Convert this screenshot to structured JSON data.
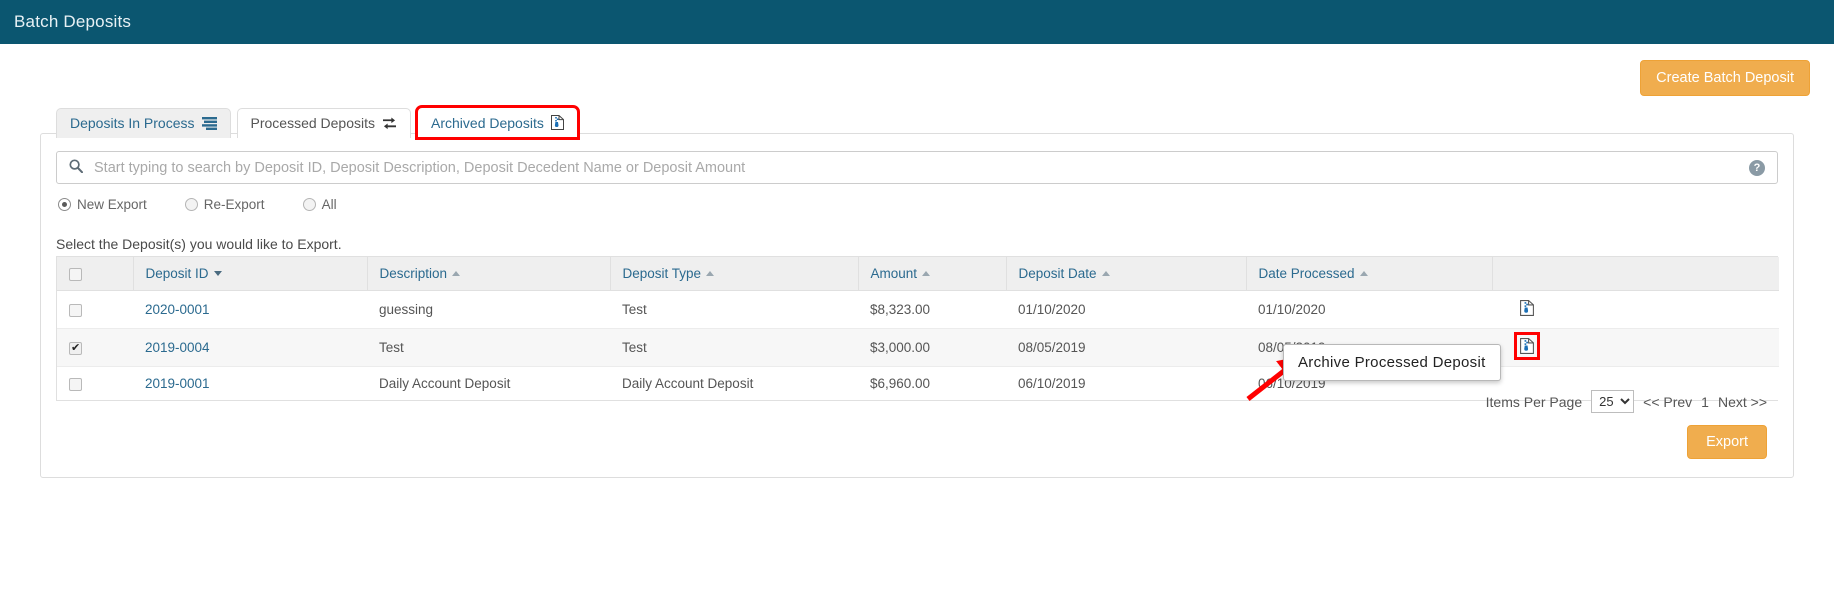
{
  "header": {
    "title": "Batch Deposits"
  },
  "actions": {
    "create_label": "Create Batch Deposit",
    "export_label": "Export"
  },
  "tabs": [
    {
      "label": "Deposits In Process",
      "icon": "list-lines-icon"
    },
    {
      "label": "Processed Deposits",
      "icon": "retweet-icon"
    },
    {
      "label": "Archived Deposits",
      "icon": "file-archive-icon"
    }
  ],
  "search": {
    "placeholder": "Start typing to search by Deposit ID, Deposit Description, Deposit Decedent Name or Deposit Amount",
    "value": "",
    "help_label": "?"
  },
  "filters": {
    "options": [
      {
        "label": "New Export",
        "selected": true
      },
      {
        "label": "Re-Export",
        "selected": false
      },
      {
        "label": "All",
        "selected": false
      }
    ]
  },
  "instruction": "Select the Deposit(s) you would like to Export.",
  "table": {
    "columns": [
      {
        "label": "",
        "sort": "none"
      },
      {
        "label": "Deposit ID",
        "sort": "desc"
      },
      {
        "label": "Description",
        "sort": "asc"
      },
      {
        "label": "Deposit Type",
        "sort": "asc"
      },
      {
        "label": "Amount",
        "sort": "asc"
      },
      {
        "label": "Deposit Date",
        "sort": "asc"
      },
      {
        "label": "Date Processed",
        "sort": "asc"
      },
      {
        "label": "",
        "sort": "none"
      }
    ],
    "rows": [
      {
        "checked": false,
        "deposit_id": "2020-0001",
        "description": "guessing",
        "deposit_type": "Test",
        "amount": "$8,323.00",
        "deposit_date": "01/10/2020",
        "date_processed": "01/10/2020",
        "action_icon": "file-archive-icon",
        "action_highlighted": false
      },
      {
        "checked": true,
        "deposit_id": "2019-0004",
        "description": "Test",
        "deposit_type": "Test",
        "amount": "$3,000.00",
        "deposit_date": "08/05/2019",
        "date_processed": "08/05/2019",
        "action_icon": "file-archive-icon",
        "action_highlighted": true
      },
      {
        "checked": false,
        "deposit_id": "2019-0001",
        "description": "Daily Account Deposit",
        "deposit_type": "Daily Account Deposit",
        "amount": "$6,960.00",
        "deposit_date": "06/10/2019",
        "date_processed": "06/10/2019",
        "action_icon": "file-archive-icon",
        "action_highlighted": false
      }
    ]
  },
  "tooltip": {
    "text": "Archive Processed Deposit"
  },
  "pagination": {
    "items_per_page_label": "Items Per Page",
    "items_per_page_value": "25",
    "prev_label": "<< Prev",
    "current_page": "1",
    "next_label": "Next >>"
  },
  "colors": {
    "header_bg": "#0b5670",
    "accent_orange": "#f0ad4e",
    "link_blue": "#2b6a8f",
    "highlight_red": "#ff0000"
  }
}
